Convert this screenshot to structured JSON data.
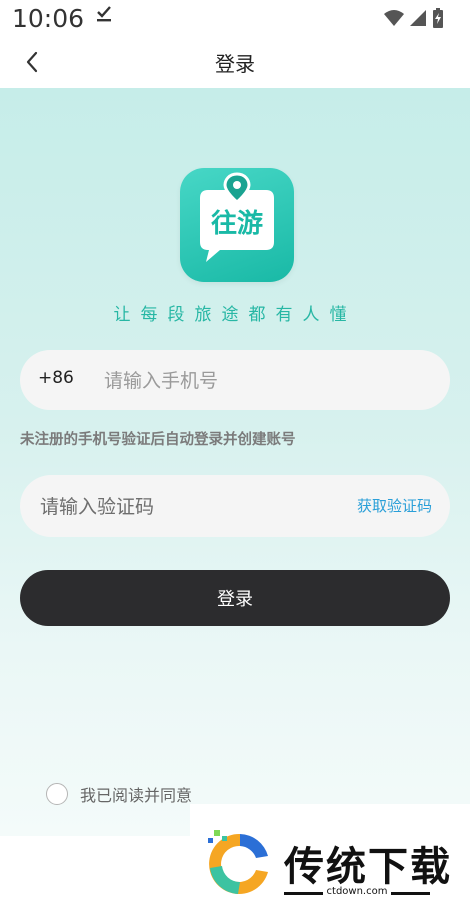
{
  "status_bar": {
    "time": "10:06"
  },
  "nav": {
    "title": "登录"
  },
  "logo": {
    "text": "往游"
  },
  "slogan": "让每段旅途都有人懂",
  "phone": {
    "prefix": "+86",
    "placeholder": "请输入手机号"
  },
  "hint": "未注册的手机号验证后自动登录并创建账号",
  "code": {
    "placeholder": "请输入验证码",
    "get_code_label": "获取验证码"
  },
  "login_button": "登录",
  "agreement": {
    "text": "我已阅读并同意"
  },
  "watermark": {
    "brand": "传统下载",
    "url": "ctdown.com"
  },
  "colors": {
    "accent": "#27b7a4",
    "link": "#2a9fd8",
    "button": "#2c2c2e"
  },
  "icons": {
    "back": "chevron-left-icon",
    "wifi": "wifi-icon",
    "signal": "signal-icon",
    "battery": "battery-icon",
    "check": "check-icon",
    "location": "location-pin-icon"
  }
}
